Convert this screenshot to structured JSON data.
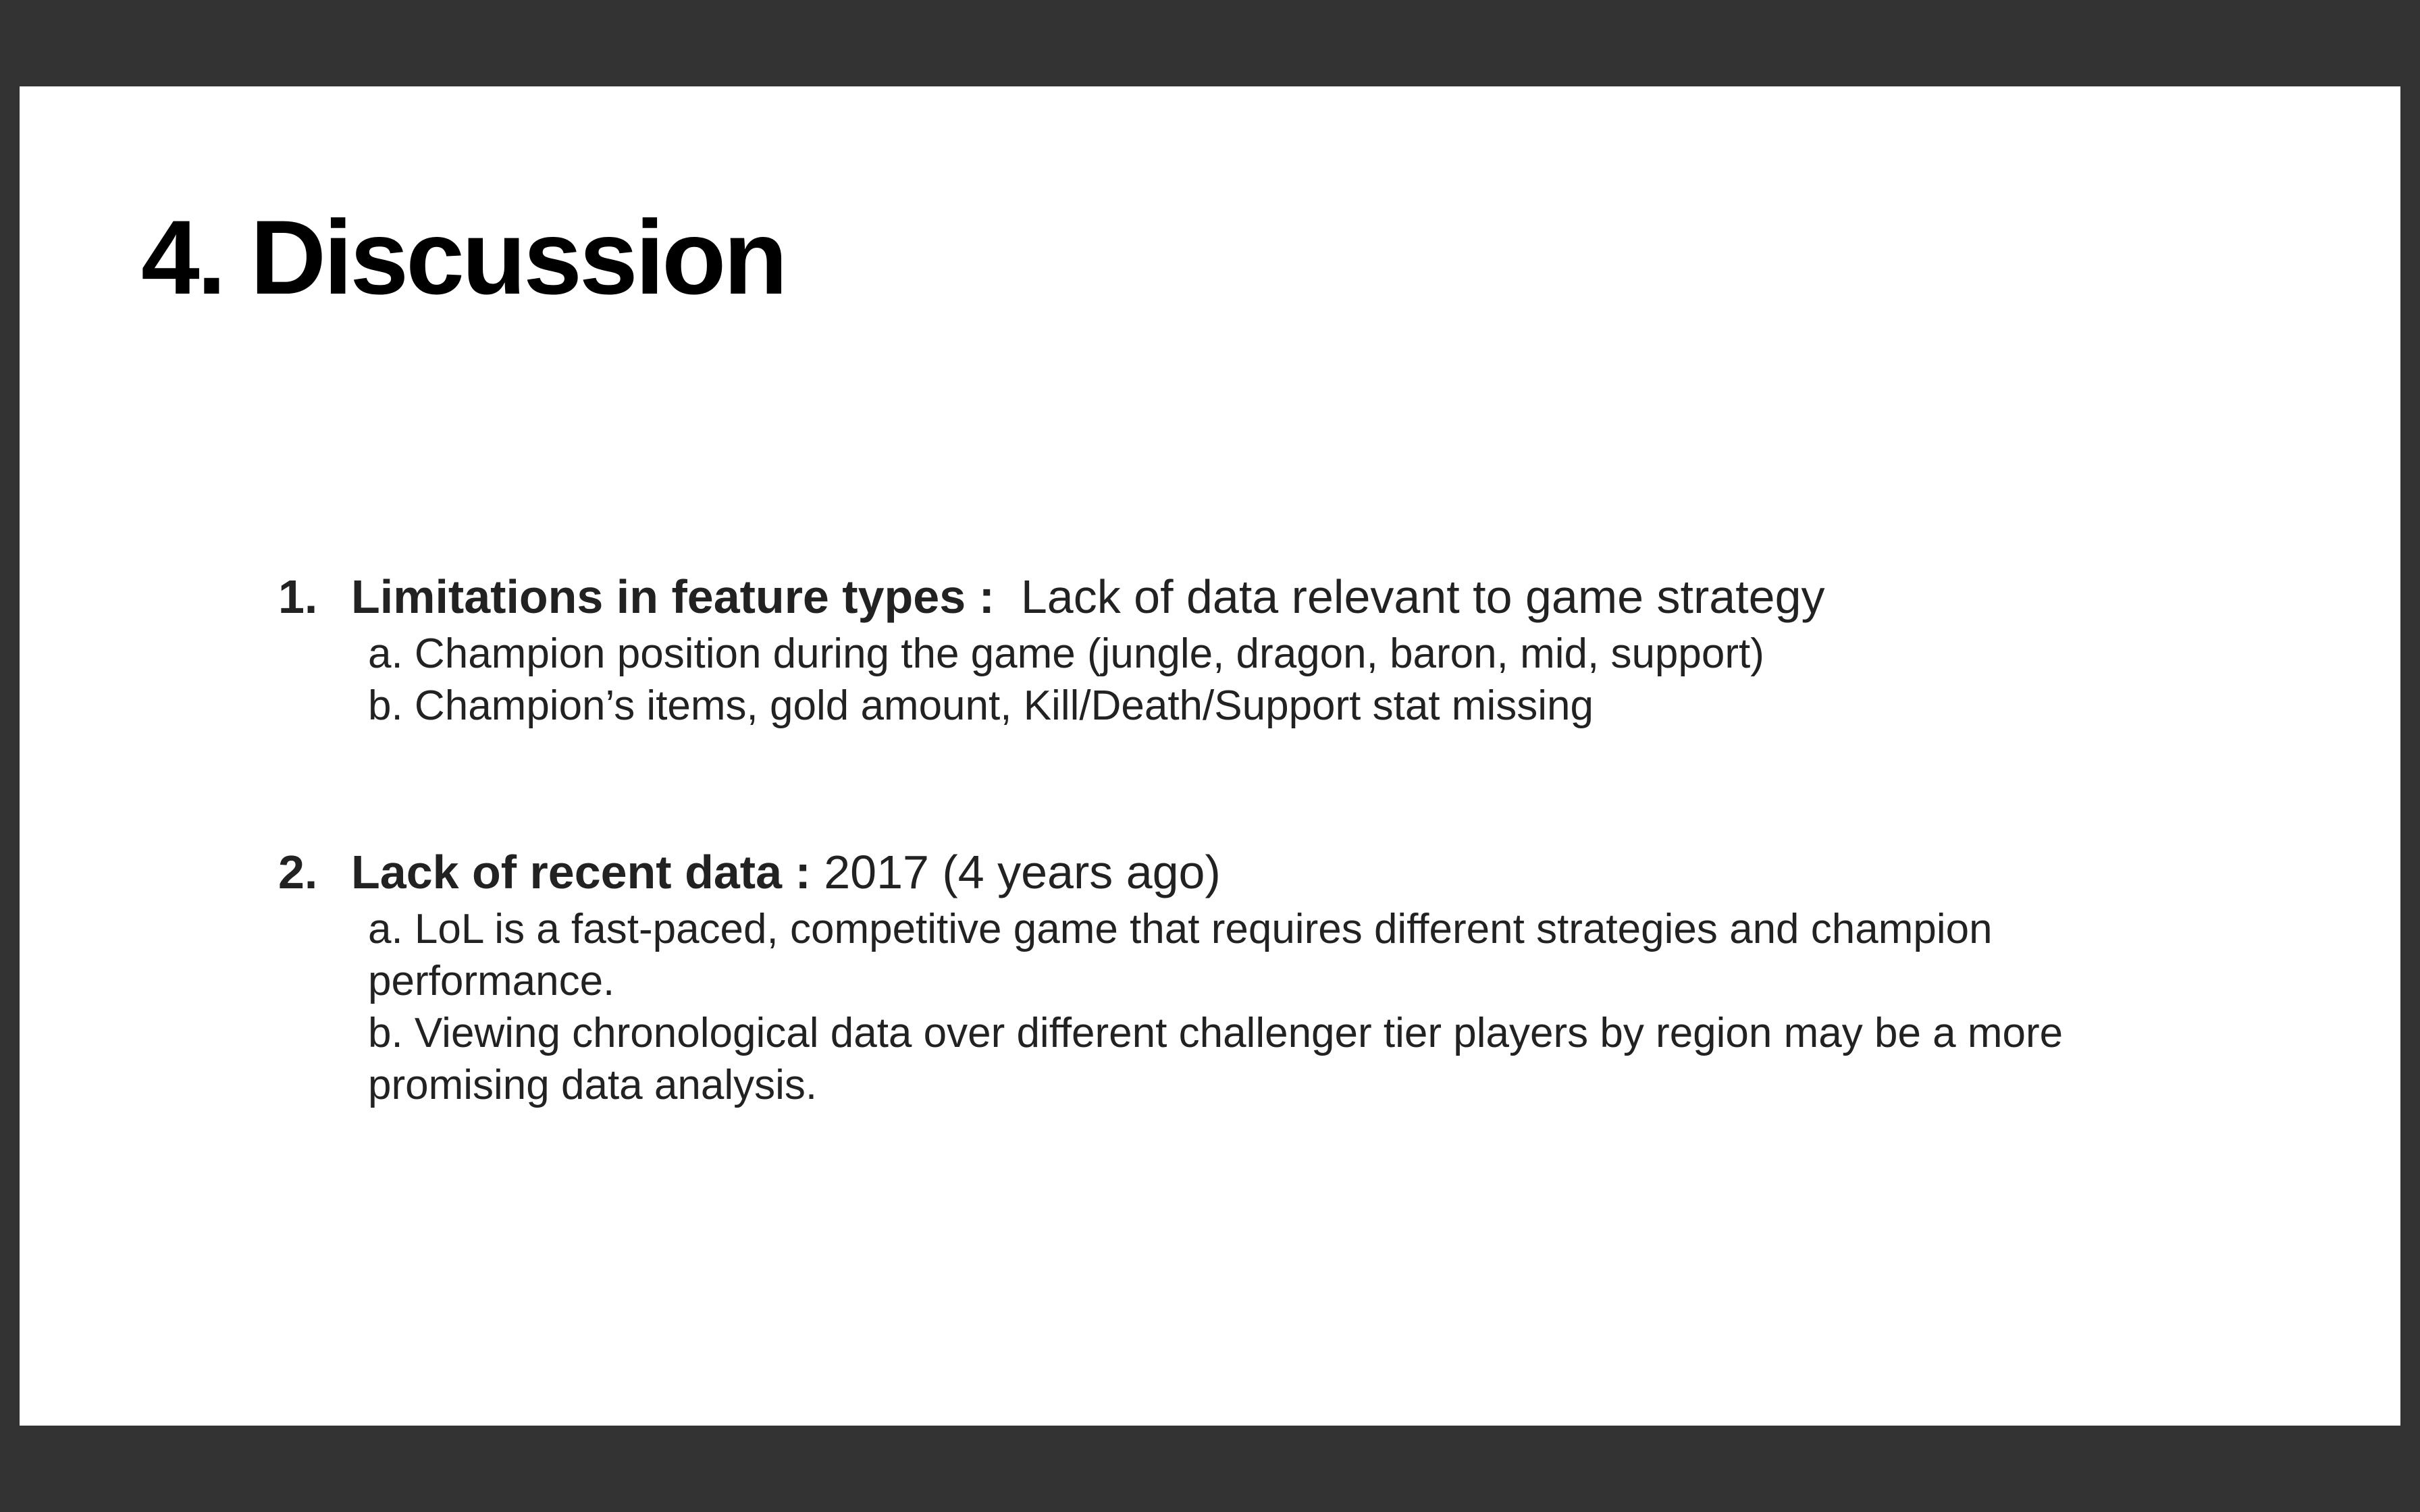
{
  "slide": {
    "title": "4. Discussion",
    "items": [
      {
        "number": "1.",
        "label": "Limitations in feature types :",
        "rest": "Lack of data relevant to game strategy",
        "subs": [
          "a. Champion position during the game (jungle, dragon, baron, mid, support)",
          "b. Champion’s items, gold amount, Kill/Death/Support stat missing"
        ]
      },
      {
        "number": "2.",
        "label": "Lack of recent data :",
        "rest": "2017 (4 years ago)",
        "subs": [
          "a. LoL is a fast-paced, competitive game that requires different strategies and champion performance.",
          "b. Viewing chronological data over different challenger tier players by region may be a more promising data analysis."
        ]
      }
    ]
  }
}
